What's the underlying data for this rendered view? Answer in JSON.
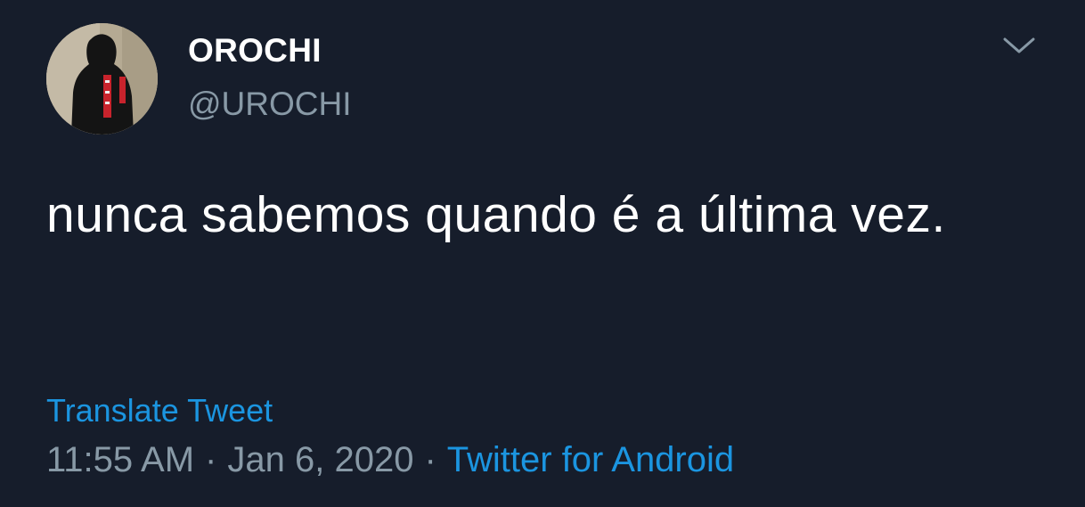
{
  "author": {
    "display_name": "OROCHI",
    "handle": "@UROCHI"
  },
  "tweet": {
    "text": "nunca sabemos quando é a última vez."
  },
  "actions": {
    "translate_label": "Translate Tweet",
    "menu_icon": "chevron-down-icon"
  },
  "meta": {
    "time": "11:55 AM",
    "separator": "·",
    "date": "Jan 6, 2020",
    "source": "Twitter for Android"
  },
  "colors": {
    "background": "#161d2b",
    "primary_text": "#ffffff",
    "secondary_text": "#8899a6",
    "link": "#1b95e0"
  }
}
